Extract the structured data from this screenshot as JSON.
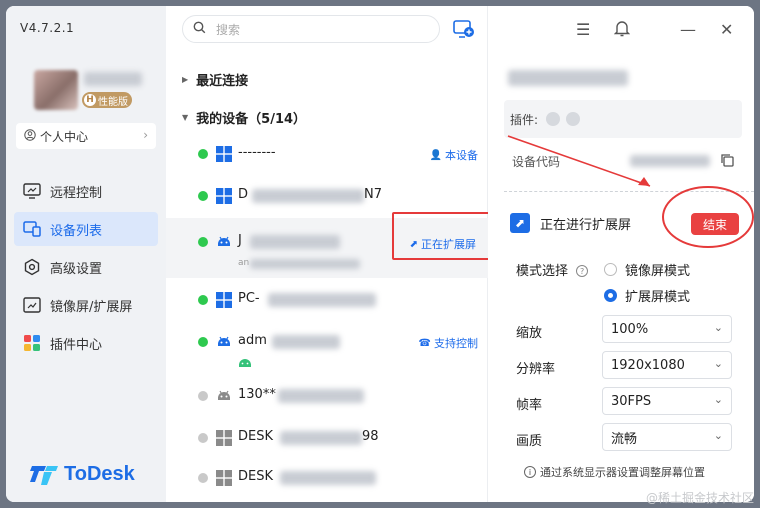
{
  "app": {
    "version": "V4.7.2.1",
    "logo_text": "ToDesk",
    "perf_badge_letter": "H",
    "perf_badge_text": "性能版",
    "personal_center": "个人中心"
  },
  "nav": [
    {
      "label": "远程控制",
      "icon": "remote-control-icon"
    },
    {
      "label": "设备列表",
      "icon": "device-list-icon",
      "active": true
    },
    {
      "label": "高级设置",
      "icon": "gear-icon"
    },
    {
      "label": "镜像屏/扩展屏",
      "icon": "screen-extend-icon"
    },
    {
      "label": "插件中心",
      "icon": "plugin-icon"
    }
  ],
  "search": {
    "placeholder": "搜索"
  },
  "groups": {
    "recent": "最近连接",
    "mine": "我的设备（5/14）"
  },
  "devices": [
    {
      "name": "--------",
      "os": "windows",
      "online": true,
      "tag": "本设备"
    },
    {
      "name": "D",
      "os": "windows",
      "online": true,
      "suffix": "N7"
    },
    {
      "name": "J",
      "os": "android",
      "online": true,
      "tag": "正在扩展屏",
      "sub": "an"
    },
    {
      "name": "PC-",
      "os": "windows",
      "online": true
    },
    {
      "name": "adm",
      "os": "android",
      "online": true,
      "tag": "支持控制"
    },
    {
      "name": "130**",
      "os": "android",
      "online": false
    },
    {
      "name": "DESK",
      "os": "windows",
      "online": false,
      "suffix": "98"
    },
    {
      "name": "DESK",
      "os": "windows",
      "online": false
    }
  ],
  "detail": {
    "plugin_label": "插件:",
    "device_code_label": "设备代码",
    "extending_text": "正在进行扩展屏",
    "end_button": "结束",
    "mode_label": "模式选择",
    "mode_options": [
      "镜像屏模式",
      "扩展屏模式"
    ],
    "mode_selected": "扩展屏模式",
    "zoom_label": "缩放",
    "zoom_value": "100%",
    "resolution_label": "分辨率",
    "resolution_value": "1920x1080",
    "fps_label": "帧率",
    "fps_value": "30FPS",
    "quality_label": "画质",
    "quality_value": "流畅",
    "hint": "通过系统显示器设置调整屏幕位置"
  },
  "watermark": "@稀土掘金技术社区",
  "colors": {
    "accent": "#1d6de5",
    "online": "#2ec94f",
    "annotation": "#e53a3a"
  }
}
